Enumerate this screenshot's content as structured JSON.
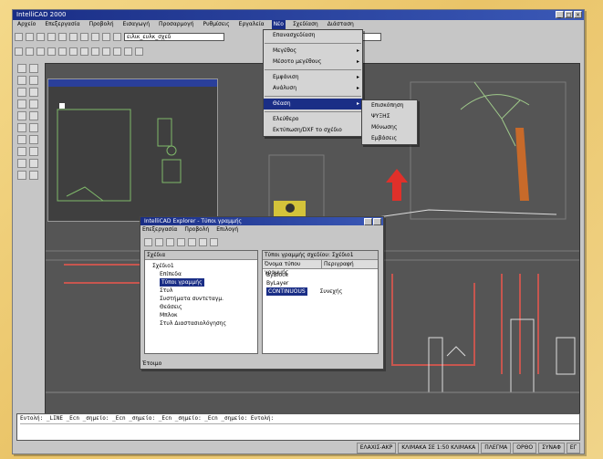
{
  "window": {
    "title": "IntelliCAD 2000",
    "buttons": [
      "_",
      "□",
      "×"
    ]
  },
  "menubar": [
    "Αρχείο",
    "Επεξεργασία",
    "Προβολή",
    "Εισαγωγή",
    "Προσαρμογή",
    "Ρυθμίσεις",
    "Εργαλεία",
    "Νέο",
    "Σχεδίαση",
    "Διάσταση"
  ],
  "toolbar": {
    "layer_value": "ειλικ_ευλκ_σχεδ"
  },
  "view_menu": {
    "items": [
      {
        "label": "Επανασχεδίαση",
        "submenu": false
      },
      {
        "label": "Μεγέθος",
        "submenu": true
      },
      {
        "label": "Μέσοτο μεγέθους",
        "submenu": true
      },
      {
        "label": "Εμφάνιση",
        "submenu": true
      },
      {
        "label": "Ανάλυση",
        "submenu": true
      },
      {
        "label": "Θέαση",
        "submenu": true,
        "highlighted": true
      },
      {
        "label": "Ελεύθερο",
        "submenu": false
      },
      {
        "label": "Εκτύπωση/DXF το σχέδιο",
        "submenu": false
      }
    ]
  },
  "sub_menu": {
    "items": [
      "Επισκόπηση",
      "ΨΥΞΗΣ",
      "Μόνωσης",
      "Εμβάσεις"
    ]
  },
  "explorer": {
    "title": "IntelliCAD Explorer - Τύποι γραμμής",
    "menu": [
      "Επεξεργασία",
      "Προβολή",
      "Επιλογή"
    ],
    "left_header": "Σχέδια",
    "tree": [
      "Σχέδιο1",
      "Επίπεδα",
      "Τύποι γραμμής",
      "Στυλ",
      "Συστήματα συντεταγμ.",
      "Θεάσεις",
      "Μπλοκ",
      "Στυλ Διαστασιολόγησης"
    ],
    "right_header": "Τύποι γραμμής σχεδίου: Σχέδιο1",
    "col1": "Όνομα τύπου γραμμής",
    "col2": "Περιγραφή",
    "rows": [
      [
        "ByBlock",
        ""
      ],
      [
        "ByLayer",
        ""
      ],
      [
        "CONTINUOUS",
        "Συνεχής"
      ]
    ],
    "status": "Έτοιμο"
  },
  "command_line": "Εντολή: _LINE _Ecn _σημείο: _Ecn _σημείο: _Ecn _σημείο: _Ecn _σημείο: Εντολή:",
  "status_bar": [
    "ΕΛΑΧΙΣ-ΑΚΡ",
    "ΚΛΙΜΑΚΑ ΣΕ 1:50 ΚΛΙΜΑΚΑ",
    "ΠΛΕΓΜΑ",
    "ΟΡΘΟ",
    "ΣΥΝΑΦ",
    "ΕΓ"
  ],
  "colors": {
    "title_blue": "#1a2e86",
    "canvas": "#5a5a5a",
    "highlight": "#1a2e86"
  }
}
